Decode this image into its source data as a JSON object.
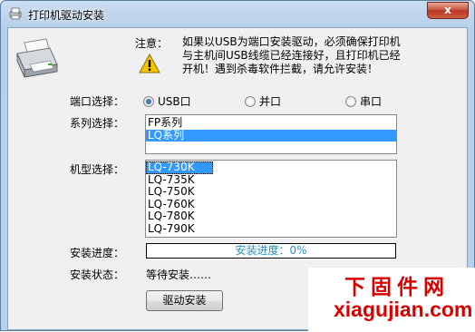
{
  "window": {
    "title": "打印机驱动安装",
    "close_glyph": "x"
  },
  "notice": {
    "label": "注意：",
    "lines": [
      "如果以USB为端口安装驱动，必须确保打印机",
      "与主机间USB线缆已经连接好，且打印机已经",
      "开机！遇到杀毒软件拦截，请允许安装！"
    ]
  },
  "port": {
    "label": "端口选择：",
    "options": [
      "USB口",
      "并口",
      "串口"
    ],
    "selected": "USB口"
  },
  "series": {
    "label": "系列选择：",
    "items": [
      "FP系列",
      "LQ系列"
    ],
    "selected": "LQ系列"
  },
  "model": {
    "label": "机型选择：",
    "items": [
      "LQ-730K",
      "LQ-735K",
      "LQ-750K",
      "LQ-760K",
      "LQ-780K",
      "LQ-790K"
    ],
    "selected": "LQ-730K"
  },
  "progress": {
    "label": "安装进度：",
    "text": "安装进度：0%",
    "value": 0
  },
  "status": {
    "label": "安装状态：",
    "text": "等待安装……"
  },
  "buttons": {
    "install": "驱动安装"
  },
  "watermark": {
    "cn": "下固件网",
    "en": "xiagujian.com"
  },
  "colors": {
    "selection": "#3399ff",
    "progress_text": "#2c8fc2",
    "watermark": "#d60000"
  }
}
